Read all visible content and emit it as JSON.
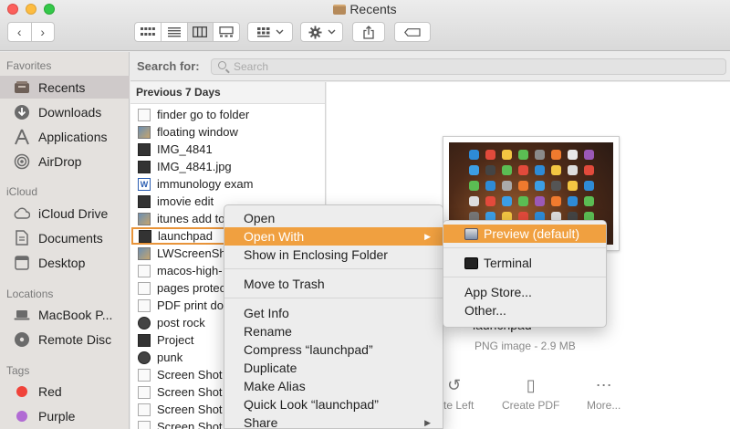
{
  "window": {
    "title": "Recents"
  },
  "toolbar": {
    "back": "‹",
    "forward": "›",
    "view_buttons": [
      "icon-view",
      "list-view",
      "column-view",
      "gallery-view"
    ],
    "active_view": "column-view"
  },
  "sidebar": {
    "favorites_heading": "Favorites",
    "favorites": [
      {
        "label": "Recents",
        "icon": "recents-icon"
      },
      {
        "label": "Downloads",
        "icon": "downloads-icon"
      },
      {
        "label": "Applications",
        "icon": "applications-icon"
      },
      {
        "label": "AirDrop",
        "icon": "airdrop-icon"
      }
    ],
    "icloud_heading": "iCloud",
    "icloud": [
      {
        "label": "iCloud Drive",
        "icon": "cloud-icon"
      },
      {
        "label": "Documents",
        "icon": "document-icon"
      },
      {
        "label": "Desktop",
        "icon": "desktop-icon"
      }
    ],
    "locations_heading": "Locations",
    "locations": [
      {
        "label": "MacBook P...",
        "icon": "laptop-icon"
      },
      {
        "label": "Remote Disc",
        "icon": "disc-icon"
      }
    ],
    "tags_heading": "Tags",
    "tags": [
      {
        "label": "Red",
        "color": "#f0433a"
      },
      {
        "label": "Purple",
        "color": "#b16bd4"
      }
    ]
  },
  "search": {
    "label": "Search for:",
    "placeholder": "Search"
  },
  "filelist": {
    "section": "Previous 7 Days",
    "items": [
      "finder go to folder",
      "floating window",
      "IMG_4841",
      "IMG_4841.jpg",
      "immunology exam",
      "imovie edit",
      "itunes add to",
      "launchpad",
      "LWScreenSh",
      "macos-high-",
      "pages protec",
      "PDF print do",
      "post rock",
      "Project",
      "punk",
      "Screen Shot",
      "Screen Shot",
      "Screen Shot",
      "Screen Shot"
    ]
  },
  "preview": {
    "name": "launchpad",
    "meta": "PNG image - 2.9 MB",
    "actions": [
      "tate Left",
      "Create PDF",
      "More..."
    ]
  },
  "context_menu": {
    "items": {
      "open": "Open",
      "open_with": "Open With",
      "show_enclosing": "Show in Enclosing Folder",
      "trash": "Move to Trash",
      "get_info": "Get Info",
      "rename": "Rename",
      "compress": "Compress “launchpad”",
      "duplicate": "Duplicate",
      "alias": "Make Alias",
      "quick_look": "Quick Look “launchpad”",
      "share": "Share"
    }
  },
  "submenu": {
    "preview": "Preview (default)",
    "terminal": "Terminal",
    "app_store": "App Store...",
    "other": "Other..."
  }
}
